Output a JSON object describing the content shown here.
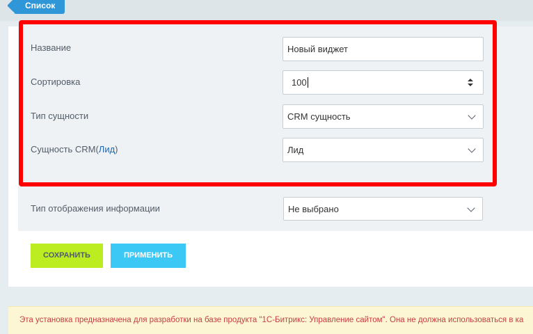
{
  "header": {
    "list_button": "Список"
  },
  "form": {
    "name": {
      "label": "Название",
      "value": "Новый виджет"
    },
    "sort": {
      "label": "Сортировка",
      "value": "100"
    },
    "entity_type": {
      "label": "Тип сущности",
      "value": "CRM сущность"
    },
    "crm_entity": {
      "label_prefix": "Сущность CRM(",
      "label_link": "Лид",
      "label_suffix": ")",
      "value": "Лид"
    },
    "display_type": {
      "label": "Тип отображения информации",
      "value": "Не выбрано"
    }
  },
  "buttons": {
    "save": "СОХРАНИТЬ",
    "apply": "ПРИМЕНИТЬ"
  },
  "notice": {
    "text": "Эта установка предназначена для разработки на базе продукта \"1С-Битрикс: Управление сайтом\". Она не должна использоваться в ка"
  },
  "colors": {
    "highlight_border": "#ff0000",
    "save_button": "#bbed21",
    "apply_button": "#3bc8f5",
    "list_button": "#2f97d8"
  }
}
